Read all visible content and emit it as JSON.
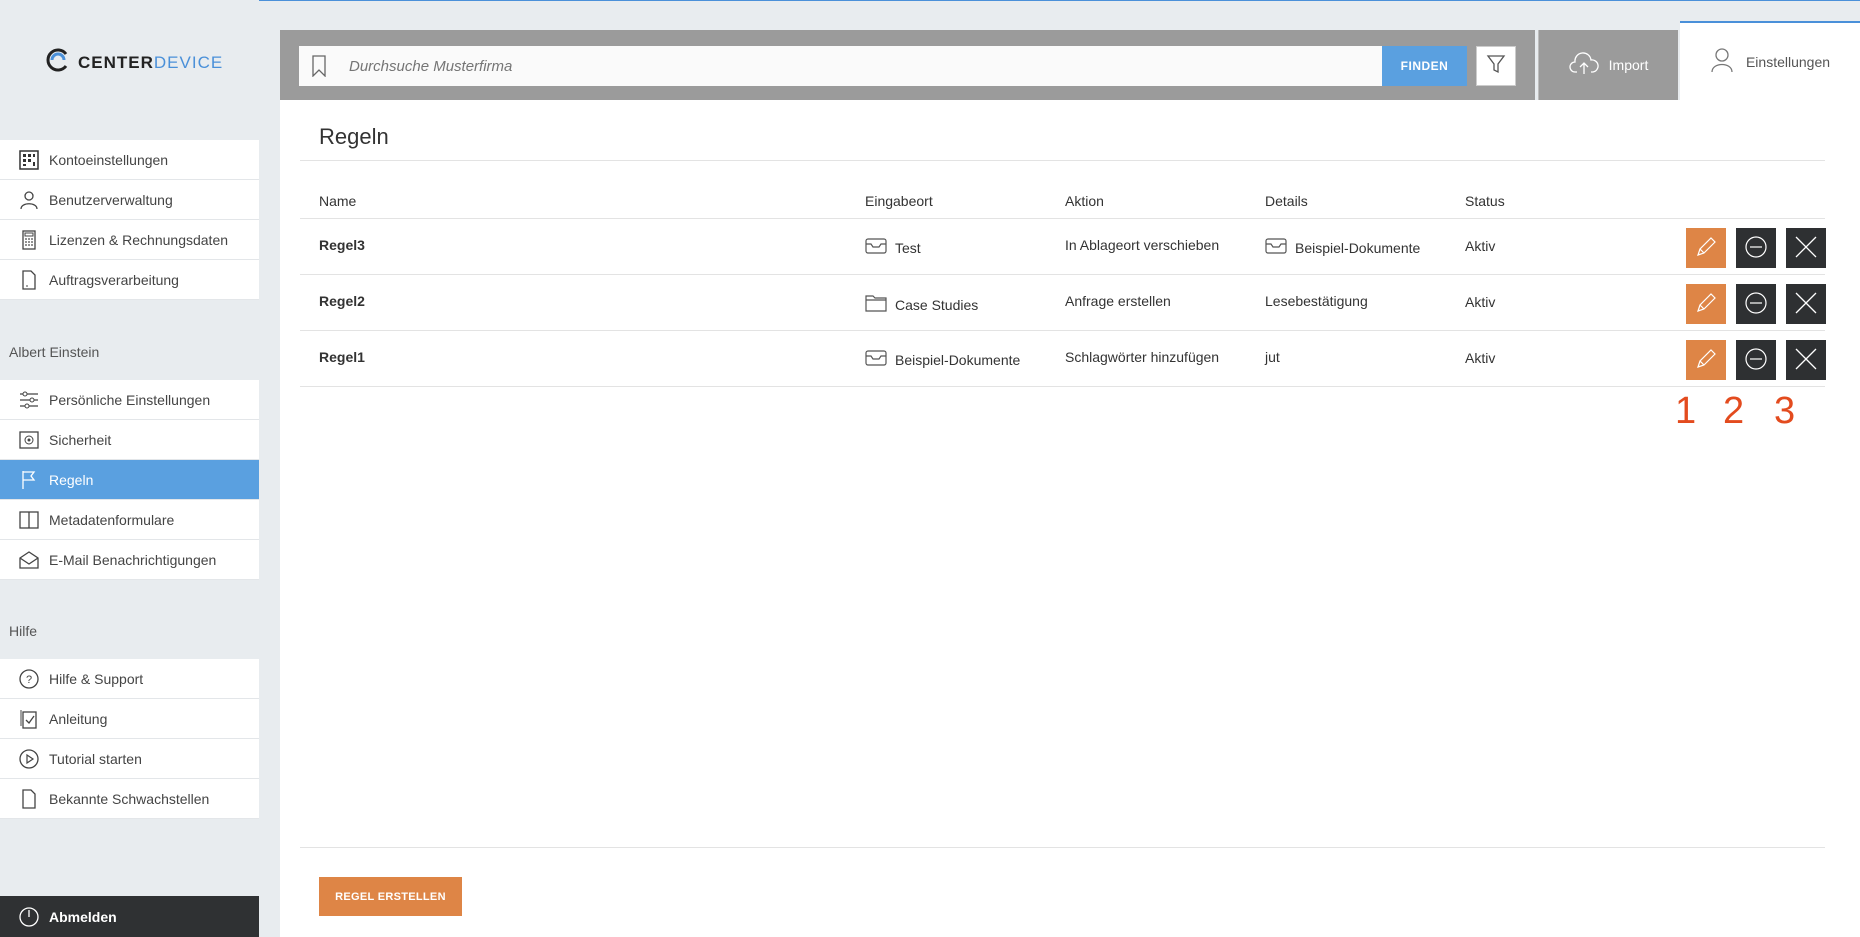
{
  "app": {
    "logo_main": "CENTER",
    "logo_accent": "DEVICE"
  },
  "sidebar": {
    "group1": [
      {
        "label": "Kontoeinstellungen",
        "icon": "grid-icon"
      },
      {
        "label": "Benutzerverwaltung",
        "icon": "user-icon"
      },
      {
        "label": "Lizenzen & Rechnungsdaten",
        "icon": "calculator-icon"
      },
      {
        "label": "Auftragsverarbeitung",
        "icon": "document-icon"
      }
    ],
    "user_section": "Albert Einstein",
    "group2": [
      {
        "label": "Persönliche Einstellungen",
        "icon": "sliders-icon"
      },
      {
        "label": "Sicherheit",
        "icon": "safe-icon"
      },
      {
        "label": "Regeln",
        "icon": "flag-icon",
        "active": true
      },
      {
        "label": "Metadatenformulare",
        "icon": "book-icon"
      },
      {
        "label": "E-Mail Benachrichtigungen",
        "icon": "envelope-icon"
      }
    ],
    "help_section": "Hilfe",
    "group3": [
      {
        "label": "Hilfe & Support",
        "icon": "question-icon"
      },
      {
        "label": "Anleitung",
        "icon": "checklist-icon"
      },
      {
        "label": "Tutorial starten",
        "icon": "play-icon"
      },
      {
        "label": "Bekannte Schwachstellen",
        "icon": "document-icon"
      }
    ],
    "logout_label": "Abmelden"
  },
  "header": {
    "search_placeholder": "Durchsuche Musterfirma",
    "find_label": "FINDEN",
    "import_label": "Import",
    "settings_label": "Einstellungen"
  },
  "main": {
    "title": "Regeln",
    "columns": [
      "Name",
      "Eingabeort",
      "Aktion",
      "Details",
      "Status"
    ],
    "rows": [
      {
        "name": "Regel3",
        "location": "Test",
        "location_icon": "inbox-icon",
        "action": "In Ablageort verschieben",
        "details": "Beispiel-Dokumente",
        "details_icon": "inbox-icon",
        "status": "Aktiv"
      },
      {
        "name": "Regel2",
        "location": "Case Studies",
        "location_icon": "folder-icon",
        "action": "Anfrage erstellen",
        "details": "Lesebestätigung",
        "details_icon": "",
        "status": "Aktiv"
      },
      {
        "name": "Regel1",
        "location": "Beispiel-Dokumente",
        "location_icon": "inbox-icon",
        "action": "Schlagwörter hinzufügen",
        "details": "jut",
        "details_icon": "",
        "status": "Aktiv"
      }
    ],
    "markers": [
      "1",
      "2",
      "3"
    ],
    "create_label": "REGEL ERSTELLEN"
  },
  "colors": {
    "accent_blue": "#5aa0e0",
    "accent_orange": "#de8546",
    "marker_red": "#e34b1e",
    "dark_button": "#2e3032"
  }
}
